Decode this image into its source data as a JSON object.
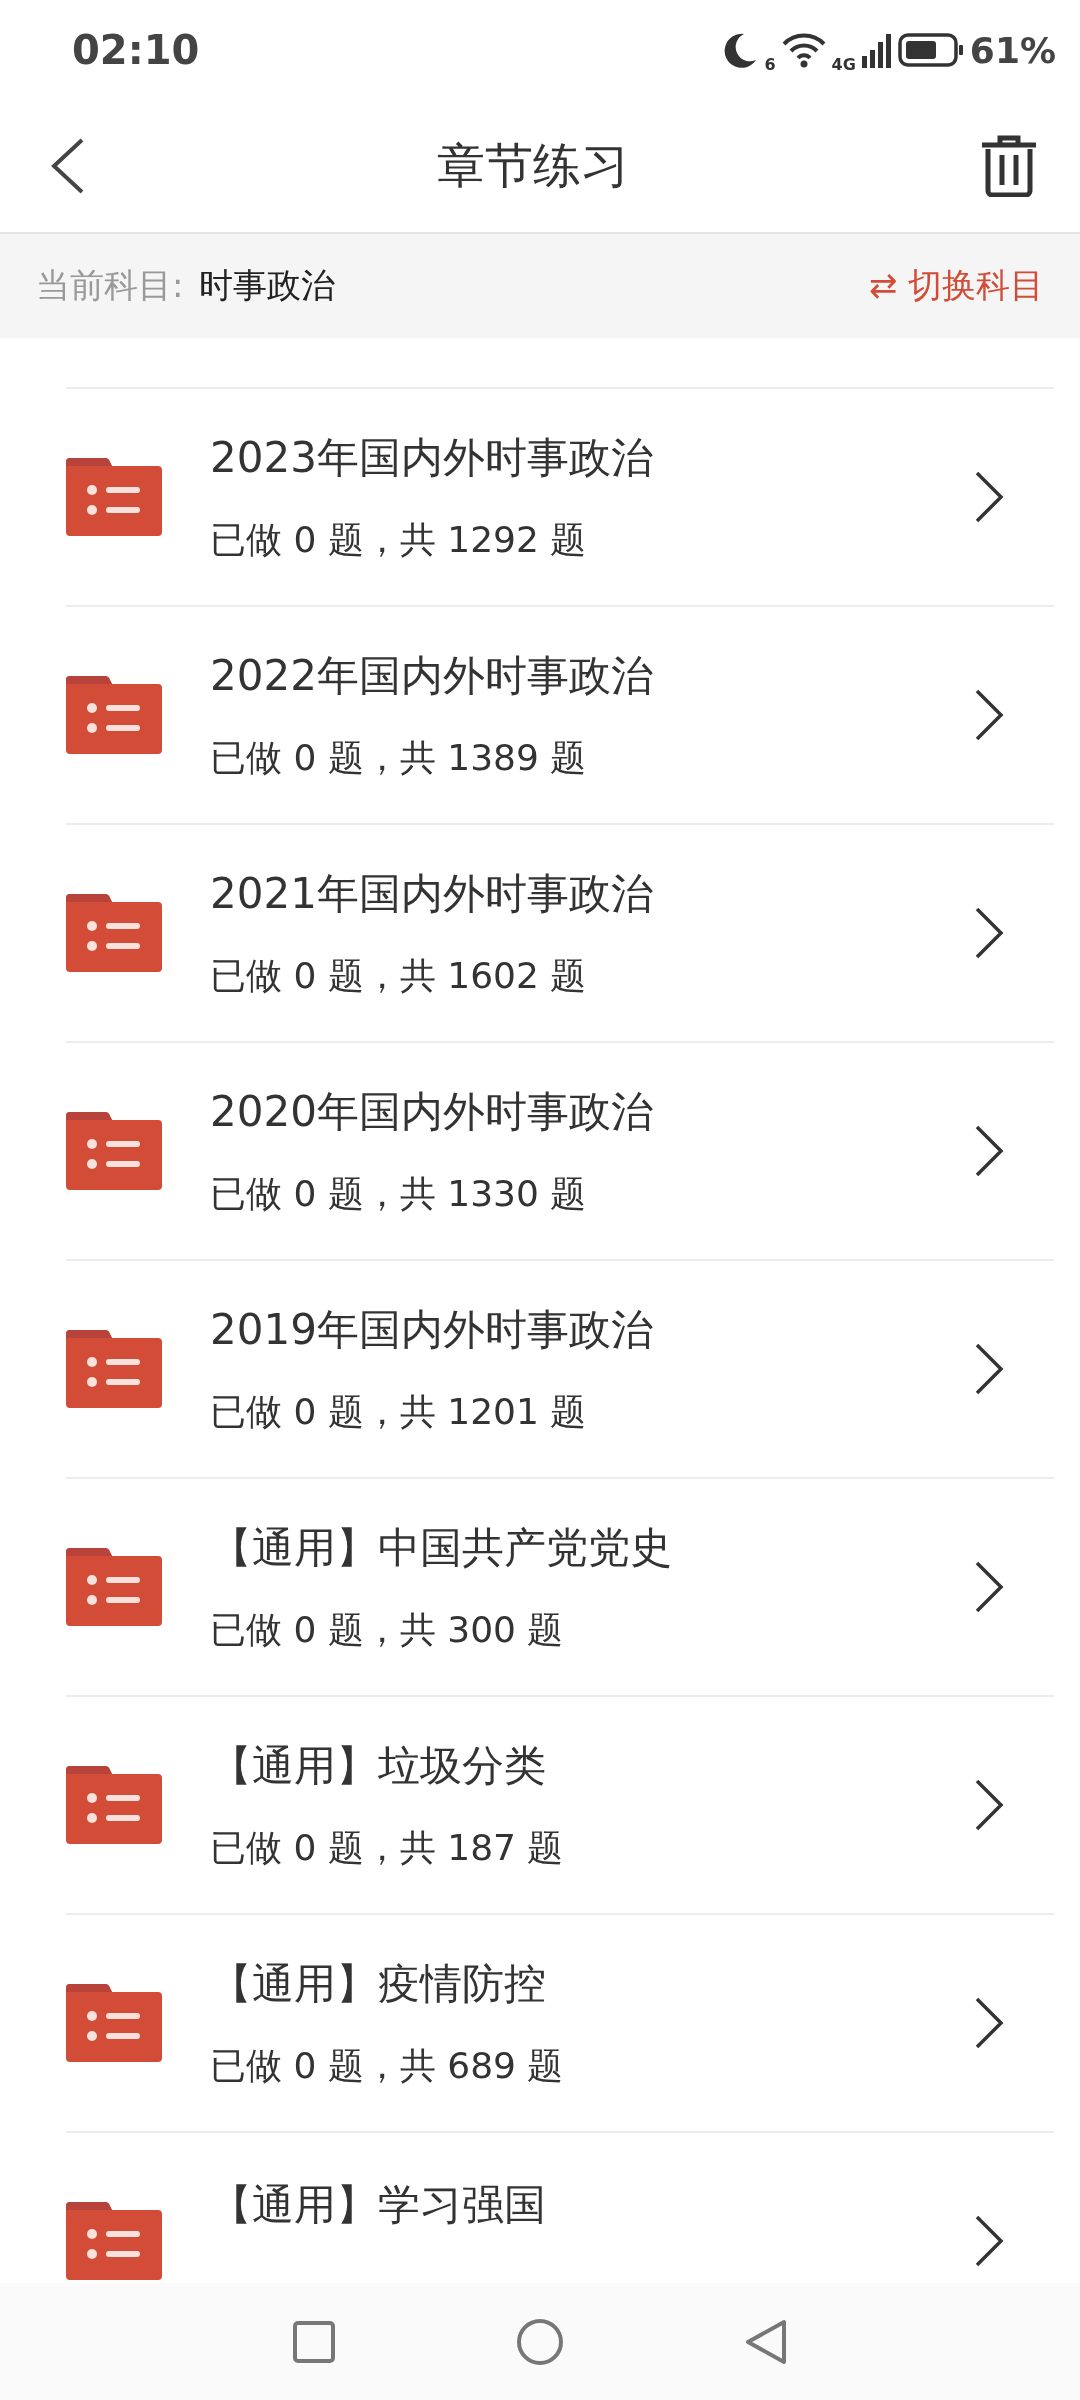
{
  "status_bar": {
    "time": "02:10",
    "wifi_label": "6",
    "network": "4G",
    "battery": "61%"
  },
  "header": {
    "title": "章节练习"
  },
  "subject_bar": {
    "label": "当前科目:",
    "subject": "时事政治",
    "switch": "⇄ 切换科目"
  },
  "chapters": [
    {
      "title": "2023年国内外时事政治",
      "count": "已做 0 题，共 1292 题"
    },
    {
      "title": "2022年国内外时事政治",
      "count": "已做 0 题，共 1389 题"
    },
    {
      "title": "2021年国内外时事政治",
      "count": "已做 0 题，共 1602 题"
    },
    {
      "title": "2020年国内外时事政治",
      "count": "已做 0 题，共 1330 题"
    },
    {
      "title": "2019年国内外时事政治",
      "count": "已做 0 题，共 1201 题"
    },
    {
      "title": "【通用】中国共产党党史",
      "count": "已做 0 题，共 300 题"
    },
    {
      "title": "【通用】垃圾分类",
      "count": "已做 0 题，共 187 题"
    },
    {
      "title": "【通用】疫情防控",
      "count": "已做 0 题，共 689 题"
    },
    {
      "title": "【通用】学习强国"
    }
  ]
}
